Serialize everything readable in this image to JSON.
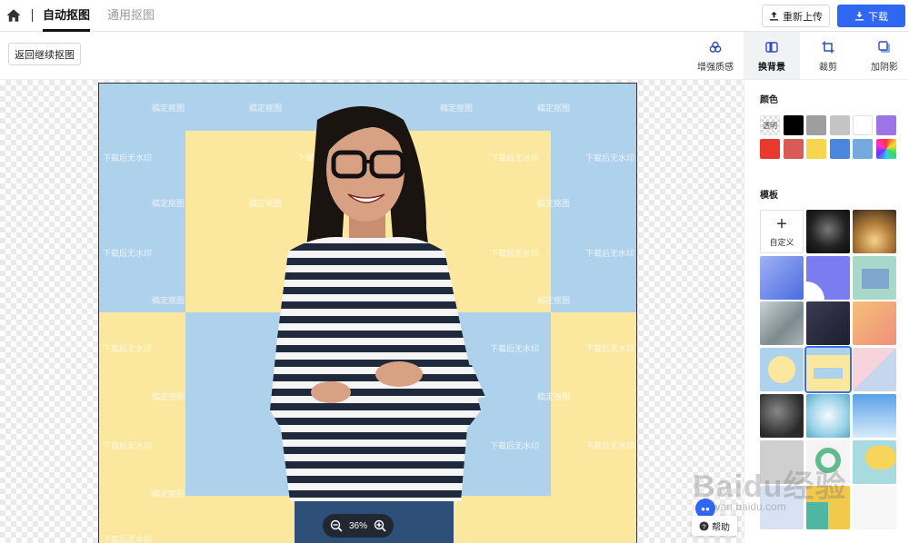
{
  "header": {
    "tabs": [
      {
        "label": "自动抠图",
        "active": true
      },
      {
        "label": "通用抠图",
        "active": false
      }
    ],
    "reupload_label": "重新上传",
    "download_label": "下载"
  },
  "toolbar": {
    "back_label": "返回继续抠图",
    "tools": [
      {
        "label": "增强质感",
        "icon": "enhance-icon",
        "active": false
      },
      {
        "label": "换背景",
        "icon": "background-icon",
        "active": true
      },
      {
        "label": "裁剪",
        "icon": "crop-icon",
        "active": false
      },
      {
        "label": "加阴影",
        "icon": "shadow-icon",
        "active": false
      }
    ]
  },
  "canvas": {
    "zoom": "36%",
    "watermarks": [
      "下载后无水印",
      "稿定抠图"
    ],
    "background_colors": {
      "blue": "#afd2ec",
      "yellow": "#fbe89e"
    }
  },
  "panel": {
    "color_heading": "颜色",
    "transparent_label": "透明",
    "colors": [
      "transparent",
      "#000000",
      "#9e9e9e",
      "#c4c4c4",
      "#ffffff",
      "#9c74e6",
      "#e8392c",
      "#d95b58",
      "#f8d54e",
      "#4a86e0",
      "#74aae0",
      "rainbow"
    ],
    "template_heading": "模板",
    "custom_label": "自定义"
  },
  "help_label": "帮助",
  "watermark_overlay": {
    "brand": "Baidu经验",
    "url": "jingyan.baidu.com"
  }
}
